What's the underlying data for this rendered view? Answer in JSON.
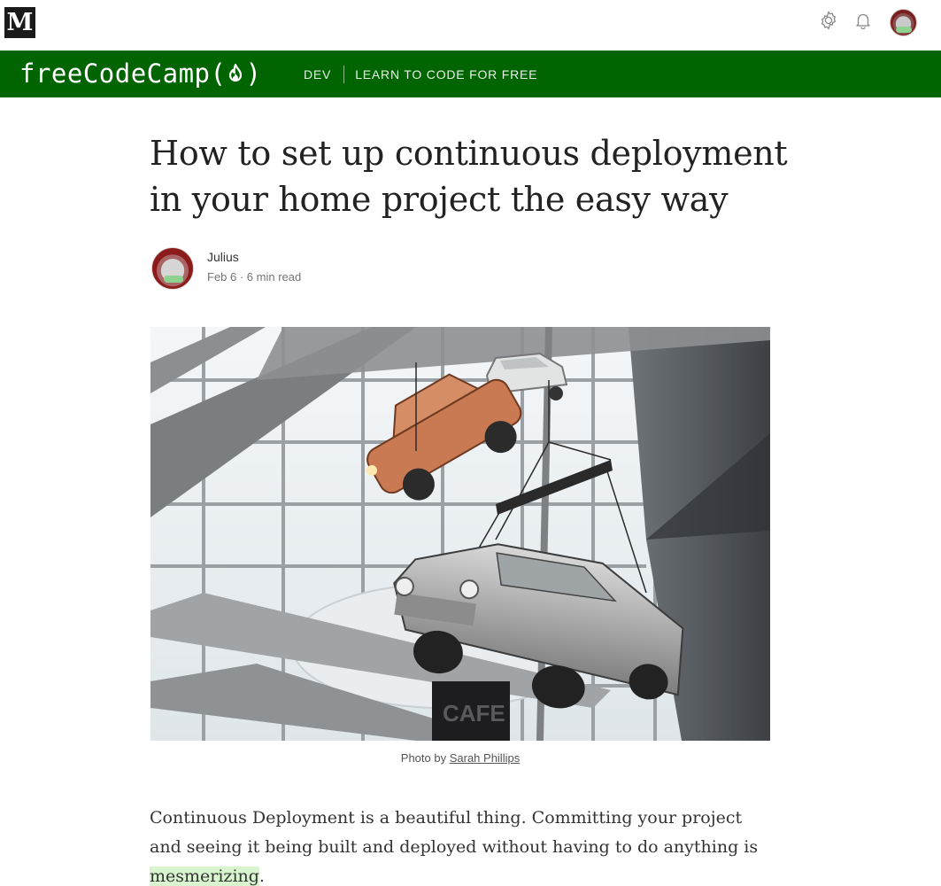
{
  "topbar": {
    "logo_letter": "M",
    "icons": [
      "gear-icon",
      "bell-icon",
      "avatar"
    ]
  },
  "publication": {
    "name": "freeCodeCamp",
    "logo_prefix": "freeCodeCamp(",
    "logo_suffix": ")",
    "bar_color": "#006400",
    "nav": [
      {
        "label": "DEV"
      },
      {
        "label": "LEARN TO CODE FOR FREE"
      }
    ]
  },
  "article": {
    "title": "How to set up continuous deployment in your home project the easy way",
    "author": "Julius",
    "meta": "Feb 6 · 6 min read",
    "caption_prefix": "Photo by ",
    "caption_credit": "Sarah Phillips",
    "body_before": "Continuous Deployment is a beautiful thing. Committing your project and seeing it being built and deployed without having to do anything is ",
    "body_highlight": "mesmerizing",
    "body_after": ".",
    "highlight_color": "#d8f5d0"
  }
}
